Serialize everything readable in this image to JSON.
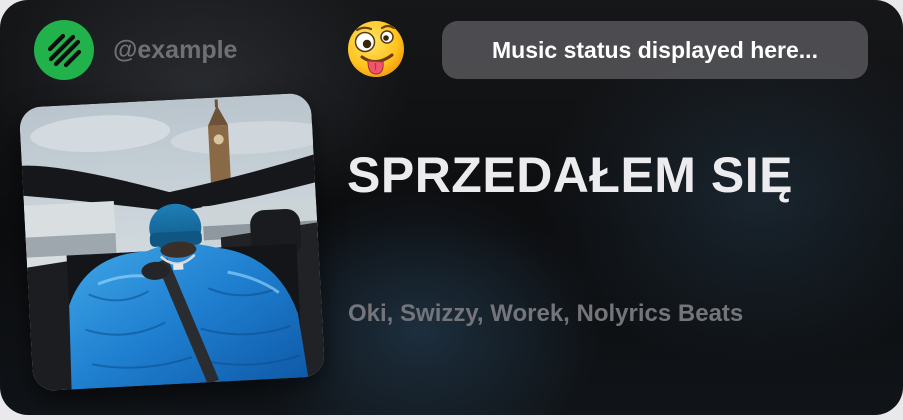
{
  "profile": {
    "username": "@example",
    "avatar_icon": "slash-logo-icon",
    "avatar_color": "#21b24c"
  },
  "status": {
    "emoji_icon": "zany-face-emoji-icon",
    "text": "Music status displayed here..."
  },
  "track": {
    "title": "SPRZEDAŁEM SIĘ",
    "artists": "Oki, Swizzy, Worek, Nolyrics Beats",
    "cover_icon": "album-cover-image"
  }
}
